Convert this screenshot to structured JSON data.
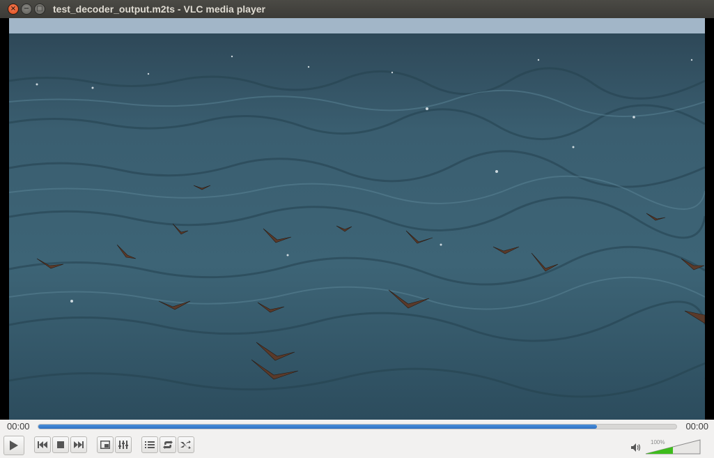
{
  "window": {
    "title": "test_decoder_output.m2ts - VLC media player"
  },
  "player": {
    "time_elapsed": "00:00",
    "time_total": "00:00",
    "progress_percent": 87.5,
    "volume_label": "100%",
    "volume_level": 0.5
  },
  "controls": [
    "play-icon",
    "previous-icon",
    "stop-icon",
    "next-icon",
    "fullscreen-icon",
    "extended-settings-icon",
    "playlist-icon",
    "loop-icon",
    "shuffle-icon",
    "speaker-icon"
  ],
  "colors": {
    "seek_fill": "#2f72c4",
    "volume_fill": "#3ebc1c",
    "titlebar": "#3c3b37",
    "close_button": "#df4a16"
  }
}
